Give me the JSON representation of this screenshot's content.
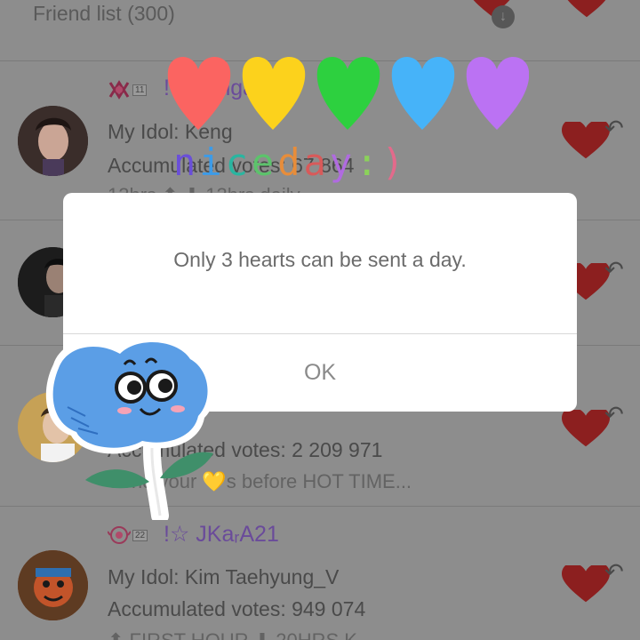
{
  "header": {
    "title": "Friend list (300)"
  },
  "rows": [
    {
      "level": "11",
      "nickname": "!☆Hanga",
      "idol_line": "My Idol: Keng",
      "votes_line": "Accumulated votes: 67 864",
      "extra_line": "13hrs ⬆ ⬇ 13hrs daily"
    },
    {
      "level": "",
      "nickname": "",
      "idol_line": "",
      "votes_line": "",
      "extra_line": ""
    },
    {
      "level": "",
      "nickname": "",
      "idol_line": "",
      "votes_line": "Accumulated votes: 2 209 971",
      "extra_line": "Send your 💛s before HOT TIME..."
    },
    {
      "level": "22",
      "nickname": "!☆ JKaᵣA21",
      "idol_line": "My Idol: Kim Taehyung_V",
      "votes_line": "Accumulated votes: 949 074",
      "extra_line": "⬆ FIRST HOUR ⬇ 20HRS K"
    }
  ],
  "dialog": {
    "message": "Only 3 hearts can be sent a day.",
    "ok_label": "OK"
  },
  "sticker": {
    "text": "nice day :)",
    "heart_colors": [
      "#fb6461",
      "#fcd21c",
      "#2dd03f",
      "#46b3f9",
      "#bb72f3"
    ],
    "letter_colors": [
      "#6a4fd8",
      "#3c9be8",
      "#2ab5a0",
      "#5cc36b",
      "#f0b335",
      "#e88d3a",
      "#d85a5a",
      "#b06be0",
      "#5b8fe6",
      "#8bd25a",
      "#e36a8b"
    ]
  },
  "colors": {
    "overlay_bg": "#8d8d8d",
    "heart_red": "#8c1f1f",
    "nickname": "#6a4b9a"
  }
}
